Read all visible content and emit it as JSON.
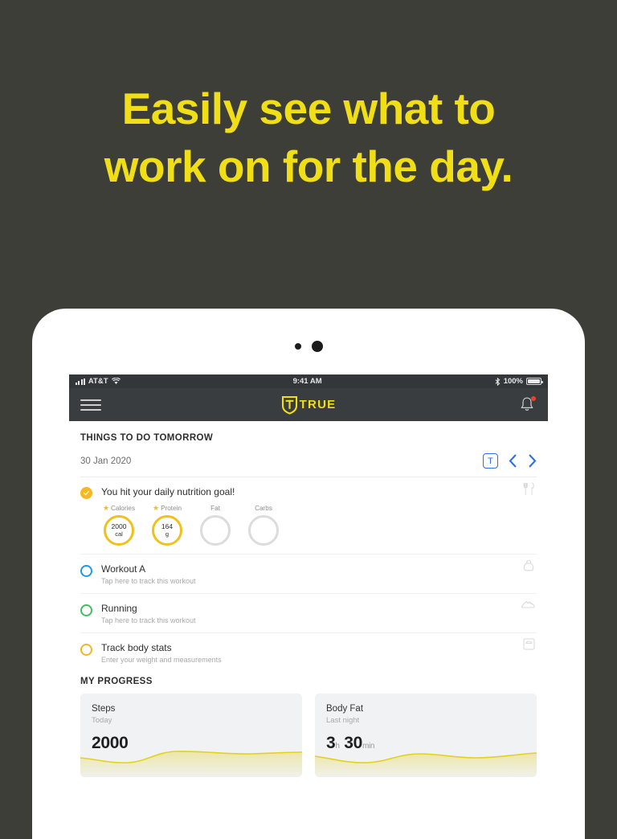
{
  "headline": {
    "line1": "Easily see what to",
    "line2": "work on for the day.",
    "color": "#f0de16"
  },
  "device": {
    "camera_icon": "camera-dot",
    "sensor_icon": "sensor-dot"
  },
  "statusbar": {
    "signal_icon": "signal-bars-icon",
    "carrier": "AT&T",
    "wifi_icon": "wifi-icon",
    "time": "9:41 AM",
    "bluetooth_icon": "bluetooth-icon",
    "battery_pct": "100%",
    "battery_icon": "battery-full-icon"
  },
  "navbar": {
    "menu_icon": "hamburger-menu-icon",
    "logo_icon": "true-shield-logo-icon",
    "brand": "TRUE",
    "bell_icon": "notification-bell-icon",
    "has_notification": true
  },
  "todo": {
    "section_title": "THINGS TO DO TOMORROW",
    "date": "30 Jan 2020",
    "today_button": "T",
    "prev_icon": "chevron-left-icon",
    "next_icon": "chevron-right-icon",
    "nutrition": {
      "title": "You hit your daily nutrition goal!",
      "status_icon": "check-circle-filled-icon",
      "row_icon": "fork-knife-icon",
      "rings": [
        {
          "label": "Calories",
          "starred": true,
          "value": "2000",
          "unit": "cal",
          "active": true
        },
        {
          "label": "Protein",
          "starred": true,
          "value": "164",
          "unit": "g",
          "active": true
        },
        {
          "label": "Fat",
          "starred": false,
          "value": "",
          "unit": "",
          "active": false
        },
        {
          "label": "Carbs",
          "starred": false,
          "value": "",
          "unit": "",
          "active": false
        }
      ]
    },
    "tasks": [
      {
        "title": "Workout A",
        "subtitle": "Tap here to track this workout",
        "ring_color": "#1b9bf0",
        "row_icon": "kettlebell-icon"
      },
      {
        "title": "Running",
        "subtitle": "Tap here to track this workout",
        "ring_color": "#3fbf5f",
        "row_icon": "running-shoe-icon"
      },
      {
        "title": "Track body stats",
        "subtitle": "Enter your weight and measurements",
        "ring_color": "#f0b722",
        "row_icon": "weight-scale-icon"
      }
    ]
  },
  "progress": {
    "section_title": "MY PROGRESS",
    "cards": [
      {
        "title": "Steps",
        "subtitle": "Today",
        "value": "2000",
        "unit": "",
        "value2": "",
        "unit2": ""
      },
      {
        "title": "Body Fat",
        "subtitle": "Last night",
        "value": "3",
        "unit": "h",
        "value2": "30",
        "unit2": "min"
      }
    ],
    "spark_color": "#e3d21a"
  }
}
